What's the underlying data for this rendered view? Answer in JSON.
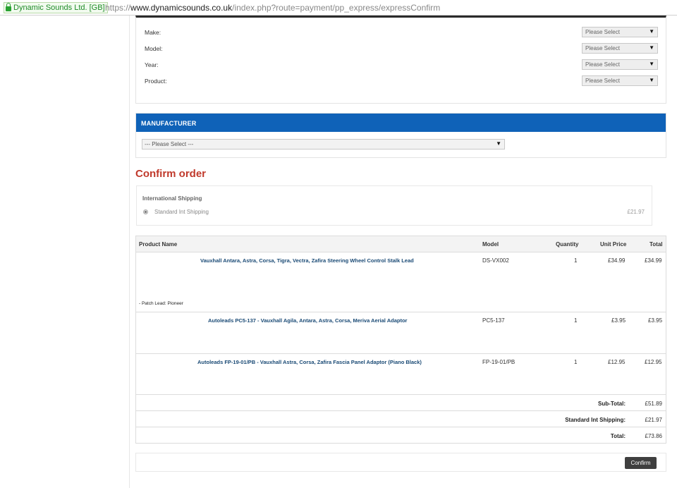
{
  "browser": {
    "secure_label": "Dynamic Sounds Ltd. [GB]",
    "url_scheme": "https://",
    "url_host": "www.dynamicsounds.co.uk",
    "url_path": "/index.php?route=payment/pp_express/expressConfirm"
  },
  "filter": {
    "rows": [
      {
        "label": "Make:",
        "value": "Please Select"
      },
      {
        "label": "Model:",
        "value": "Please Select"
      },
      {
        "label": "Year:",
        "value": "Please Select"
      },
      {
        "label": "Product:",
        "value": "Please Select"
      }
    ]
  },
  "manufacturer": {
    "title": "MANUFACTURER",
    "select_value": "--- Please Select ---"
  },
  "confirm_title": "Confirm order",
  "shipping": {
    "heading": "International Shipping",
    "option": "Standard Int Shipping",
    "price": "£21.97"
  },
  "table": {
    "headers": [
      "Product Name",
      "Model",
      "Quantity",
      "Unit Price",
      "Total"
    ],
    "rows": [
      {
        "name": "Vauxhall Antara, Astra, Corsa, Tigra, Vectra, Zafira Steering Wheel Control Stalk Lead",
        "option": "- Patch Lead: Pioneer",
        "model": "DS-VX002",
        "qty": "1",
        "price": "£34.99",
        "total": "£34.99"
      },
      {
        "name": "Autoleads PC5-137 - Vauxhall Agila, Antara, Astra, Corsa, Meriva Aerial Adaptor",
        "option": "",
        "model": "PC5-137",
        "qty": "1",
        "price": "£3.95",
        "total": "£3.95"
      },
      {
        "name": "Autoleads FP-19-01/PB - Vauxhall Astra, Corsa, Zafira Fascia Panel Adaptor (Piano Black)",
        "option": "",
        "model": "FP-19-01/PB",
        "qty": "1",
        "price": "£12.95",
        "total": "£12.95"
      }
    ],
    "totals": [
      {
        "label": "Sub-Total:",
        "value": "£51.89"
      },
      {
        "label": "Standard Int Shipping:",
        "value": "£21.97"
      },
      {
        "label": "Total:",
        "value": "£73.86"
      }
    ]
  },
  "confirm_button": "Confirm"
}
